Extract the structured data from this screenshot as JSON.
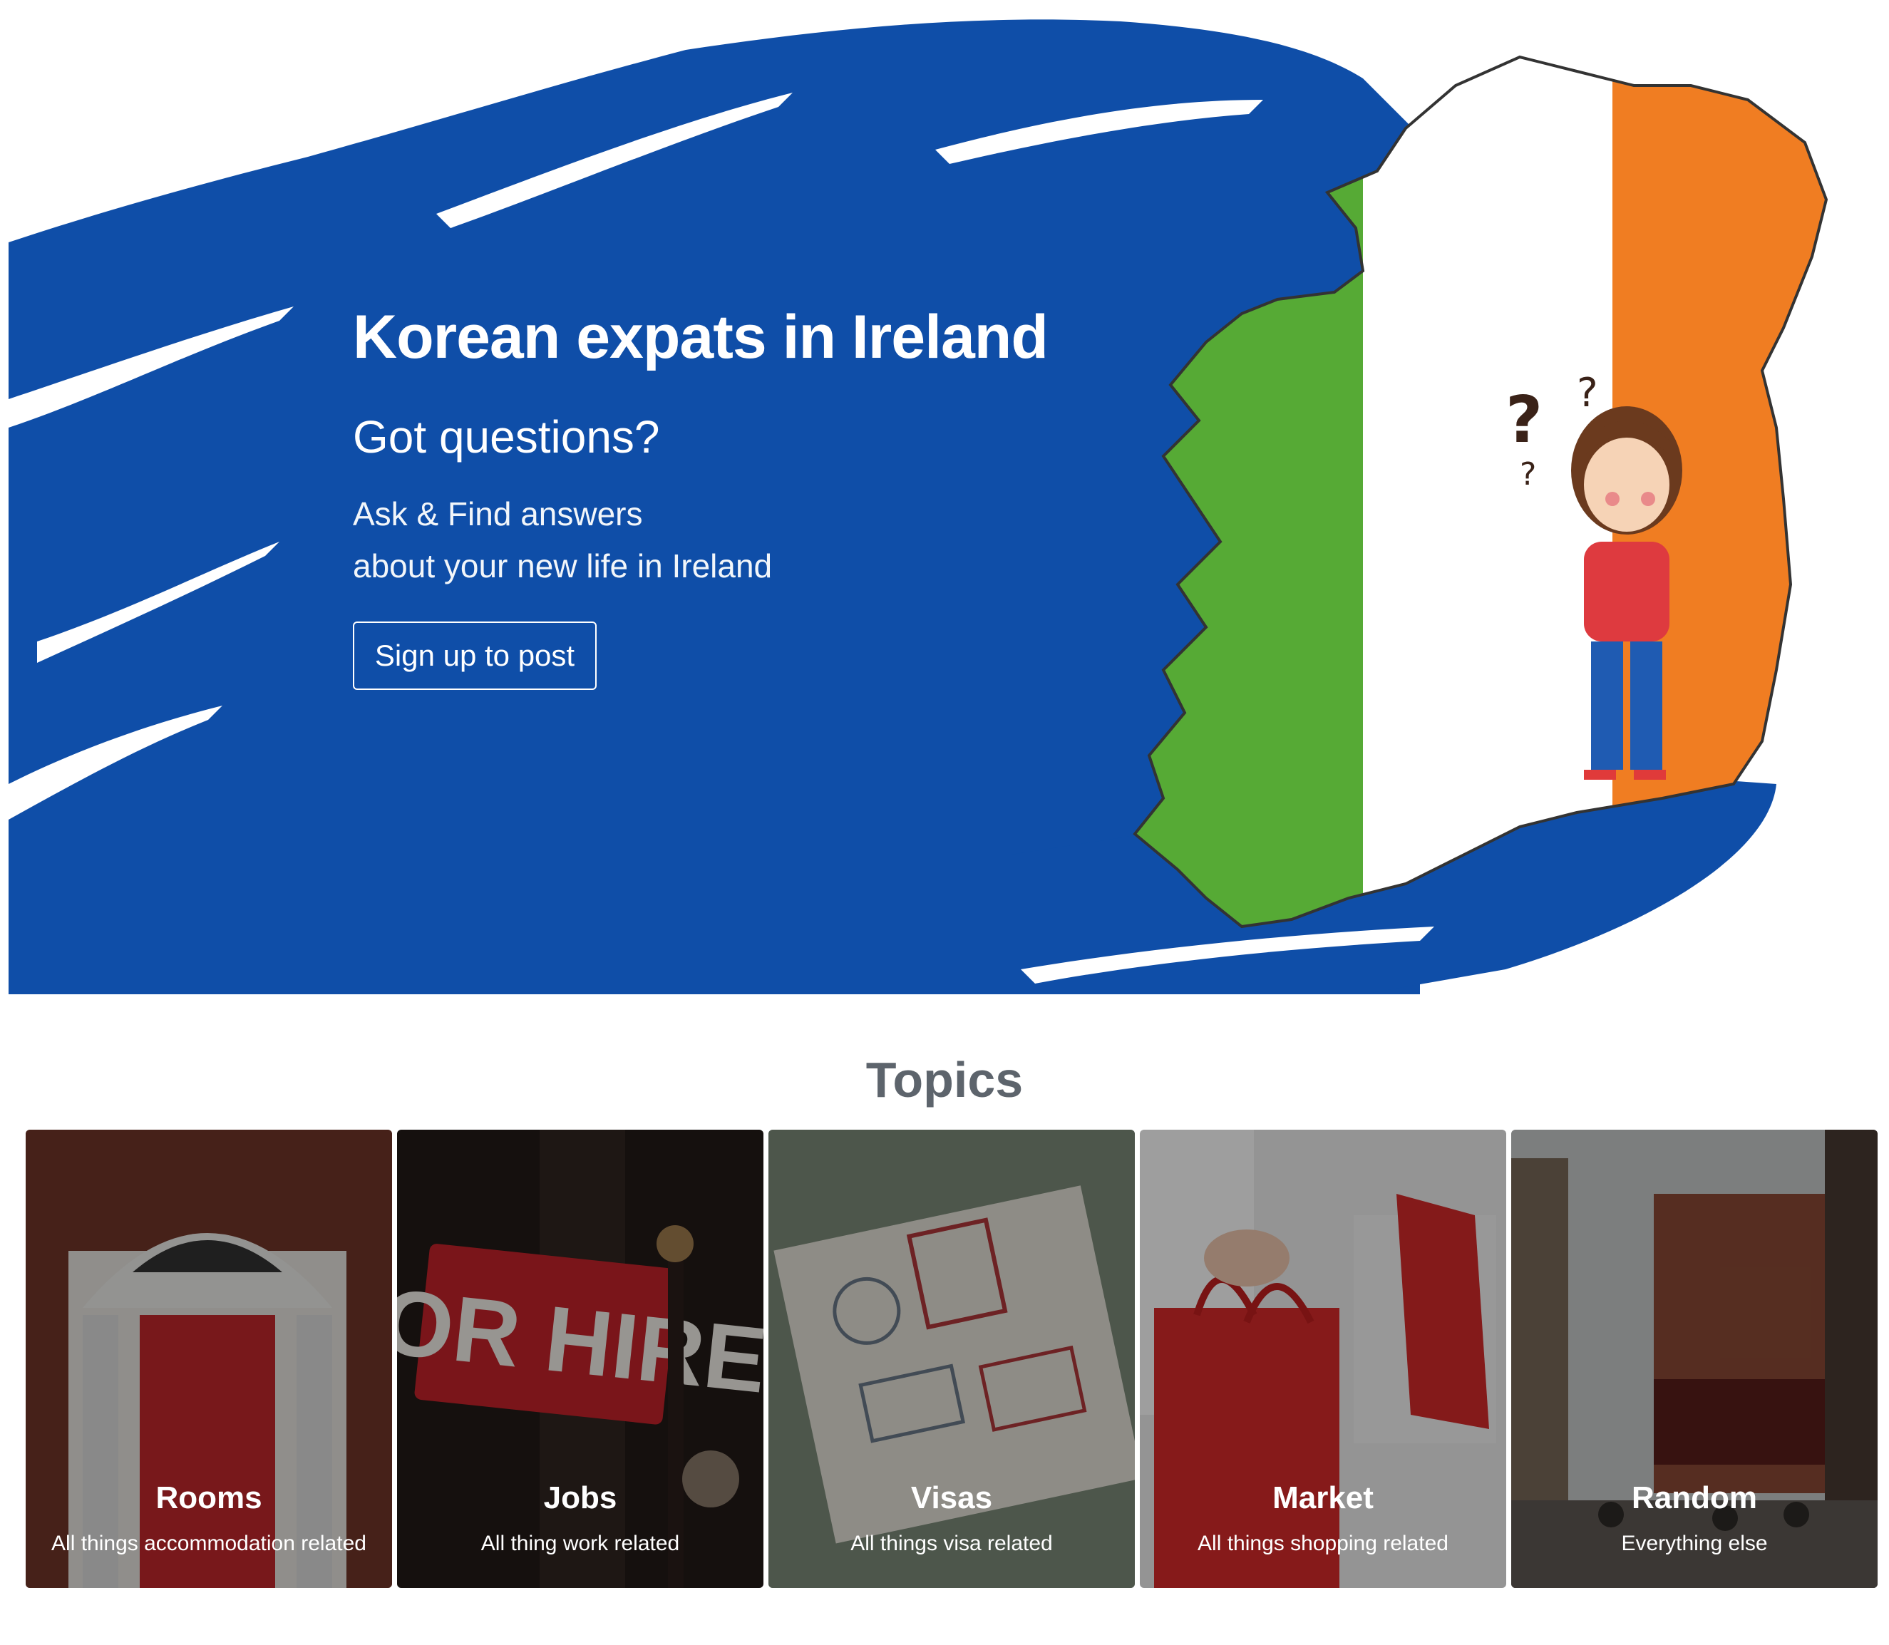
{
  "hero": {
    "title": "Korean expats in Ireland",
    "subtitle": "Got questions?",
    "desc_line1": "Ask & Find answers",
    "desc_line2": "about your new life in Ireland",
    "cta_label": "Sign up to post",
    "colors": {
      "brush_blue": "#0f4ea8",
      "flag_green": "#56aa35",
      "flag_white": "#ffffff",
      "flag_orange": "#f07d22"
    }
  },
  "topics": {
    "heading": "Topics",
    "items": [
      {
        "title": "Rooms",
        "desc": "All things accommodation related",
        "icon": "red-door-photo"
      },
      {
        "title": "Jobs",
        "desc": "All thing work related",
        "icon": "for-hire-sign-photo"
      },
      {
        "title": "Visas",
        "desc": "All things visa related",
        "icon": "passport-stamps-photo"
      },
      {
        "title": "Market",
        "desc": "All things shopping related",
        "icon": "shopping-bags-photo"
      },
      {
        "title": "Random",
        "desc": "Everything else",
        "icon": "street-pub-photo"
      }
    ]
  },
  "map": {
    "labels": [
      "?",
      "?",
      "?"
    ]
  }
}
